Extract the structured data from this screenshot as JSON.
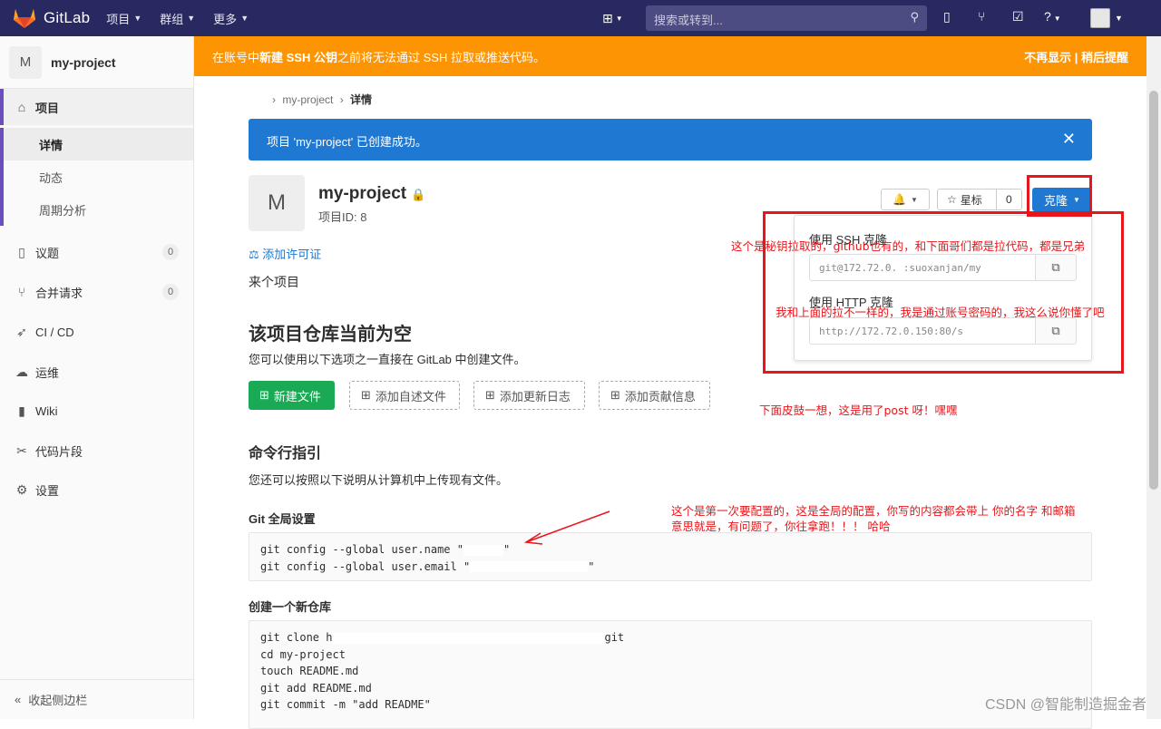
{
  "topbar": {
    "brand": "GitLab",
    "menu": [
      {
        "label": "项目"
      },
      {
        "label": "群组"
      },
      {
        "label": "更多"
      }
    ],
    "search_placeholder": "搜索或转到..."
  },
  "sidebar": {
    "project_initial": "M",
    "project_name": "my-project",
    "items": [
      {
        "label": "项目"
      },
      {
        "label": "详情"
      },
      {
        "label": "动态"
      },
      {
        "label": "周期分析"
      },
      {
        "label": "议题",
        "count": "0"
      },
      {
        "label": "合并请求",
        "count": "0"
      },
      {
        "label": "CI / CD"
      },
      {
        "label": "运维"
      },
      {
        "label": "Wiki"
      },
      {
        "label": "代码片段"
      },
      {
        "label": "设置"
      }
    ],
    "collapse_label": "收起侧边栏"
  },
  "warning": {
    "text_pre": "在账号中 ",
    "text_bold": "新建 SSH 公钥",
    "text_post": " 之前将无法通过 SSH 拉取或推送代码。",
    "dismiss": "不再显示 | 稍后提醒"
  },
  "breadcrumb": {
    "sep": "›",
    "project": "my-project",
    "current": "详情"
  },
  "flash": {
    "message": "项目 'my-project' 已创建成功。",
    "close": "✕"
  },
  "project": {
    "initial": "M",
    "title": "my-project",
    "id_label": "项目ID: 8",
    "license_link": "添加许可证",
    "description": "来个项目"
  },
  "actions": {
    "star_label": "星标",
    "star_count": "0",
    "clone_label": "克隆"
  },
  "clone_dropdown": {
    "ssh_label": "使用 SSH 克隆",
    "ssh_url": "git@172.72.0.          :suoxanjan/my",
    "http_label": "使用 HTTP 克隆",
    "http_url": "http://172.72.0.150:80/s"
  },
  "empty_repo": {
    "title": "该项目仓库当前为空",
    "subtitle": "您可以使用以下选项之一直接在 GitLab 中创建文件。",
    "buttons": [
      {
        "label": "新建文件"
      },
      {
        "label": "添加自述文件"
      },
      {
        "label": "添加更新日志"
      },
      {
        "label": "添加贡献信息"
      }
    ]
  },
  "cli": {
    "title": "命令行指引",
    "subtitle": "您还可以按照以下说明从计算机中上传现有文件。",
    "global_title": "Git 全局设置",
    "global_lines": [
      "git config --global user.name \"",
      "git config --global user.email \""
    ],
    "new_repo_title": "创建一个新仓库",
    "new_repo_lines": [
      "git clone h",
      "git",
      "cd my-project",
      "touch README.md",
      "git add README.md",
      "git commit -m \"add README\""
    ]
  },
  "annotations": {
    "a1": "这个是秘钥拉取的，github也有的，和下面哥们都是拉代码，都是兄弟",
    "a2": "我和上面的拉不一样的，我是通过账号密码的，我这么说你懂了吧",
    "a3": "下面皮鼓一想，这是用了post 呀！嘿嘿",
    "a4_line1": "这个是第一次要配置的，这是全局的配置，你写的内容都会带上 你的名字 和邮箱",
    "a4_line2": "意思就是，有问题了，你往拿跑！！！ 哈哈"
  },
  "watermark": "CSDN @智能制造掘金者",
  "colors": {
    "topbar": "#292961",
    "warning": "#fc9403",
    "flash": "#1f78d1",
    "annotation": "#e8151a",
    "new_file_button": "#1aaa55"
  }
}
